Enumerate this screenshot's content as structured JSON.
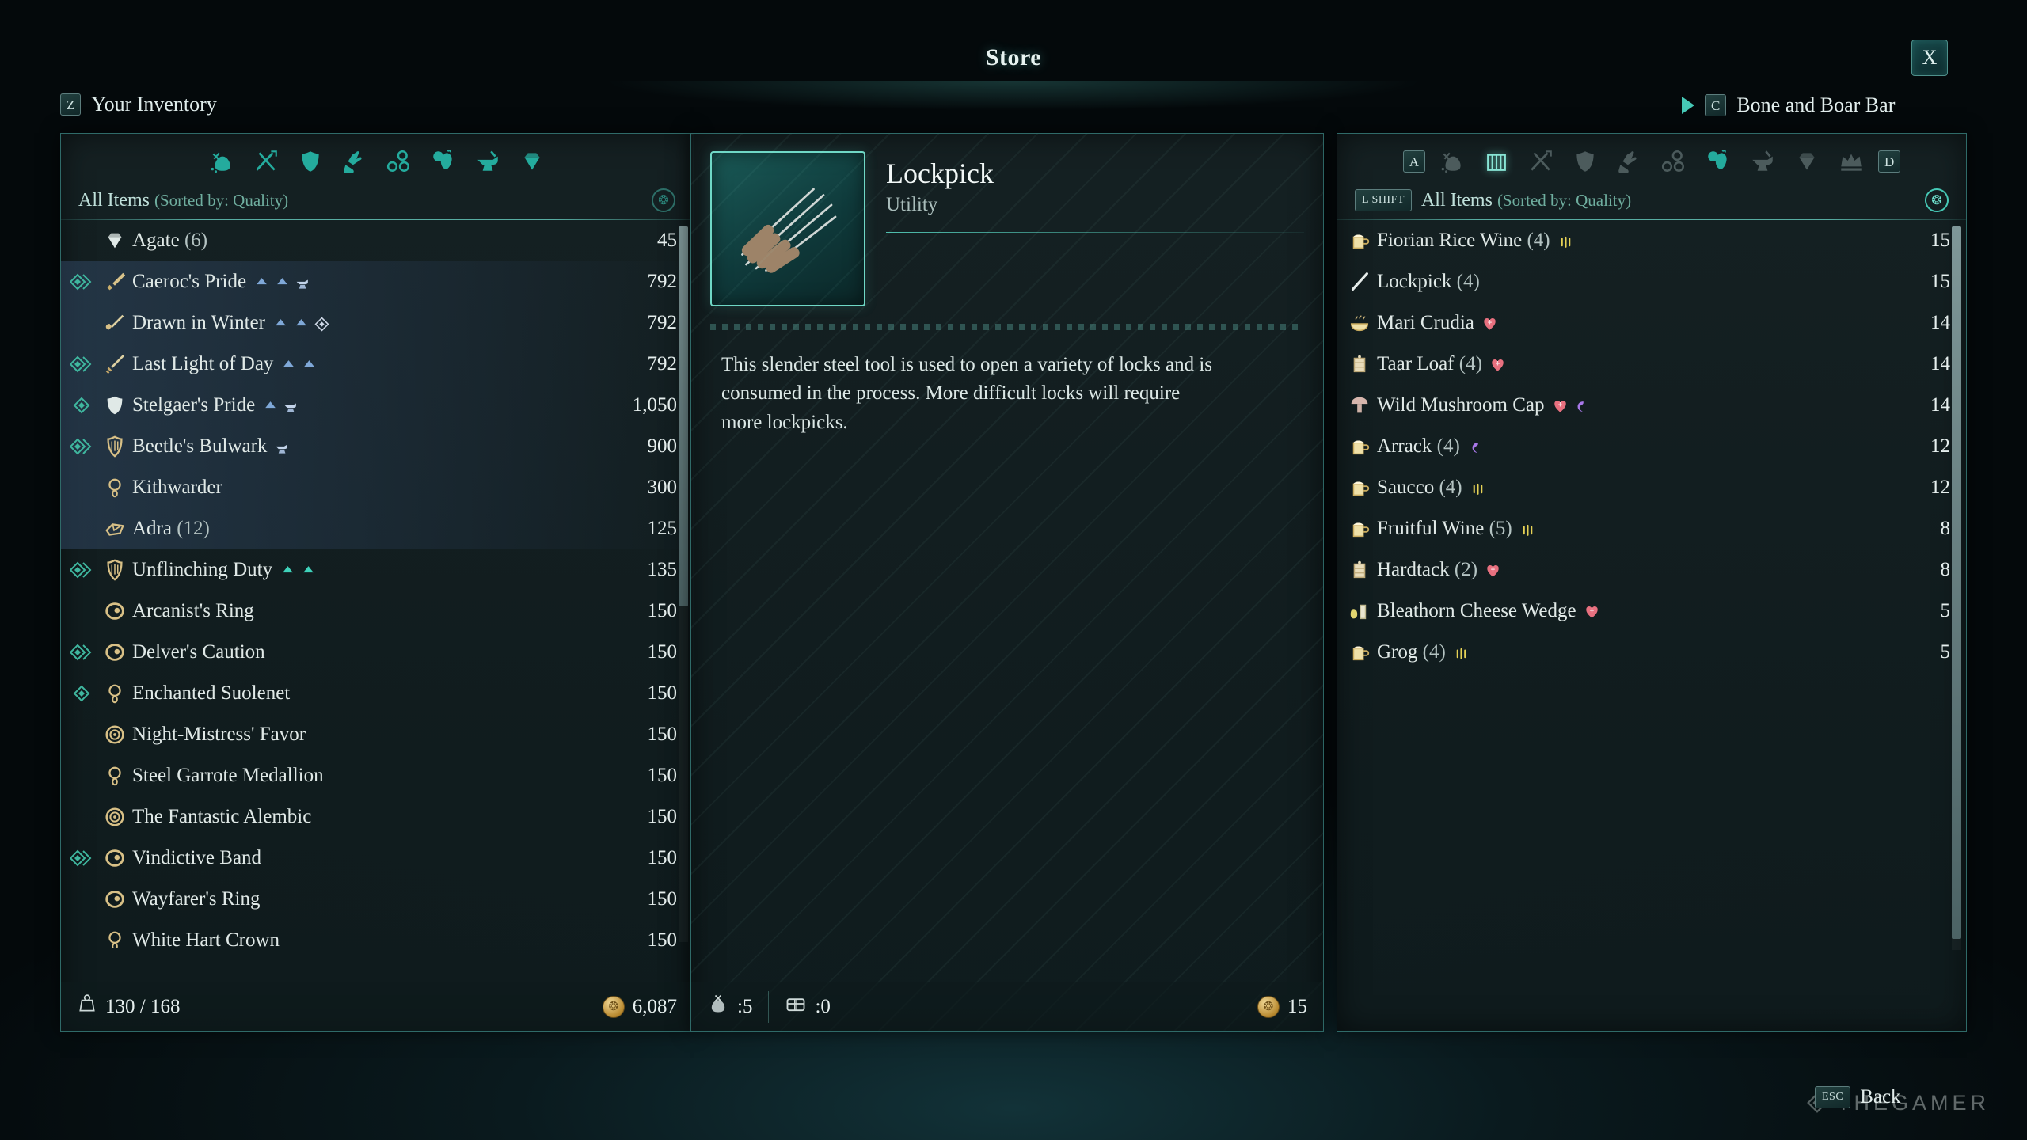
{
  "header": {
    "store_title": "Store",
    "close_label": "X",
    "inventory_key": "Z",
    "inventory_label": "Your Inventory",
    "shop_key": "C",
    "shop_label": "Bone and Boar Bar"
  },
  "left_panel": {
    "sort_key": "",
    "sort_label": "All Items",
    "sort_sub": "(Sorted by: Quality)",
    "weight_label": "130 / 168",
    "gold_label": "6,087",
    "items": [
      {
        "name": "Agate",
        "qty": "(6)",
        "price": "45",
        "icon": "gem-icon",
        "equipped": false,
        "highlight": false,
        "badges": []
      },
      {
        "name": "Caeroc's Pride",
        "qty": "",
        "price": "792",
        "icon": "dagger-icon",
        "equipped": true,
        "eqtype": "double",
        "highlight": true,
        "badges": [
          "up",
          "up",
          "anvil"
        ]
      },
      {
        "name": "Drawn in Winter",
        "qty": "",
        "price": "792",
        "icon": "axe-icon",
        "equipped": false,
        "highlight": true,
        "badges": [
          "up",
          "up",
          "diamond"
        ]
      },
      {
        "name": "Last Light of Day",
        "qty": "",
        "price": "792",
        "icon": "sword-icon",
        "equipped": true,
        "eqtype": "double",
        "highlight": true,
        "badges": [
          "up",
          "up"
        ]
      },
      {
        "name": "Stelgaer's Pride",
        "qty": "",
        "price": "1,050",
        "icon": "armor-icon",
        "equipped": true,
        "eqtype": "single",
        "highlight": true,
        "badges": [
          "up",
          "anvil"
        ]
      },
      {
        "name": "Beetle's Bulwark",
        "qty": "",
        "price": "900",
        "icon": "shield-icon",
        "equipped": true,
        "eqtype": "double",
        "highlight": true,
        "badges": [
          "anvil"
        ]
      },
      {
        "name": "Kithwarder",
        "qty": "",
        "price": "300",
        "icon": "amulet-icon",
        "equipped": false,
        "highlight": true,
        "badges": []
      },
      {
        "name": "Adra",
        "qty": "(12)",
        "price": "125",
        "icon": "adra-icon",
        "equipped": false,
        "highlight": true,
        "badges": []
      },
      {
        "name": "Unflinching Duty",
        "qty": "",
        "price": "135",
        "icon": "shield-icon",
        "equipped": true,
        "eqtype": "double",
        "highlight": false,
        "badges": [
          "upteal",
          "upteal"
        ]
      },
      {
        "name": "Arcanist's Ring",
        "qty": "",
        "price": "150",
        "icon": "ring-icon",
        "equipped": false,
        "highlight": false,
        "badges": []
      },
      {
        "name": "Delver's Caution",
        "qty": "",
        "price": "150",
        "icon": "ring-icon",
        "equipped": true,
        "eqtype": "double",
        "highlight": false,
        "badges": []
      },
      {
        "name": "Enchanted Suolenet",
        "qty": "",
        "price": "150",
        "icon": "amulet-icon",
        "equipped": true,
        "eqtype": "single",
        "highlight": false,
        "badges": []
      },
      {
        "name": "Night-Mistress' Favor",
        "qty": "",
        "price": "150",
        "icon": "medallion-icon",
        "equipped": false,
        "highlight": false,
        "badges": []
      },
      {
        "name": "Steel Garrote Medallion",
        "qty": "",
        "price": "150",
        "icon": "amulet-icon",
        "equipped": false,
        "highlight": false,
        "badges": []
      },
      {
        "name": "The Fantastic Alembic",
        "qty": "",
        "price": "150",
        "icon": "medallion-icon",
        "equipped": false,
        "highlight": false,
        "badges": []
      },
      {
        "name": "Vindictive Band",
        "qty": "",
        "price": "150",
        "icon": "ring-icon",
        "equipped": true,
        "eqtype": "double",
        "highlight": false,
        "badges": []
      },
      {
        "name": "Wayfarer's Ring",
        "qty": "",
        "price": "150",
        "icon": "ring-icon",
        "equipped": false,
        "highlight": false,
        "badges": []
      },
      {
        "name": "White Hart Crown",
        "qty": "",
        "price": "150",
        "icon": "amulet-icon",
        "equipped": false,
        "highlight": false,
        "badges": []
      }
    ],
    "categories": [
      {
        "icon": "loot-bag-icon",
        "state": "on"
      },
      {
        "icon": "weapons-icon",
        "state": "on"
      },
      {
        "icon": "armor-icon",
        "state": "on"
      },
      {
        "icon": "gloves-boots-icon",
        "state": "on"
      },
      {
        "icon": "jewelry-icon",
        "state": "on"
      },
      {
        "icon": "consumables-icon",
        "state": "on"
      },
      {
        "icon": "anvil-icon",
        "state": "on"
      },
      {
        "icon": "gem-icon",
        "state": "on"
      }
    ]
  },
  "detail": {
    "name": "Lockpick",
    "type": "Utility",
    "description": "This slender steel tool is used to open a variety of locks and is consumed in the process. More difficult locks will require more lockpicks.",
    "icon": "lockpick-icon",
    "foot_pouch_count": ":5",
    "foot_stash_count": ":0",
    "foot_price": "15"
  },
  "right_panel": {
    "key_left": "A",
    "key_right": "D",
    "sort_key": "L SHIFT",
    "sort_label": "All Items",
    "sort_sub": "(Sorted by: Quality)",
    "items": [
      {
        "name": "Fiorian Rice Wine",
        "qty": "(4)",
        "price": "15",
        "icon": "mug-icon",
        "badges": [
          "intox"
        ]
      },
      {
        "name": "Lockpick",
        "qty": "(4)",
        "price": "15",
        "icon": "lockpick-small-icon",
        "badges": []
      },
      {
        "name": "Mari Crudia",
        "qty": "",
        "price": "14",
        "icon": "bowl-icon",
        "badges": [
          "heart"
        ]
      },
      {
        "name": "Taar Loaf",
        "qty": "(4)",
        "price": "14",
        "icon": "bread-icon",
        "badges": [
          "heart"
        ]
      },
      {
        "name": "Wild Mushroom Cap",
        "qty": "",
        "price": "14",
        "icon": "mushroom-icon",
        "badges": [
          "heart",
          "spirit"
        ]
      },
      {
        "name": "Arrack",
        "qty": "(4)",
        "price": "12",
        "icon": "mug-icon",
        "badges": [
          "spirit"
        ]
      },
      {
        "name": "Saucco",
        "qty": "(4)",
        "price": "12",
        "icon": "mug-icon",
        "badges": [
          "intox"
        ]
      },
      {
        "name": "Fruitful Wine",
        "qty": "(5)",
        "price": "8",
        "icon": "mug-icon",
        "badges": [
          "intox"
        ]
      },
      {
        "name": "Hardtack",
        "qty": "(2)",
        "price": "8",
        "icon": "bread-icon",
        "badges": [
          "heart"
        ]
      },
      {
        "name": "Bleathorn Cheese Wedge",
        "qty": "",
        "price": "5",
        "icon": "cheese-icon",
        "badges": [
          "heart"
        ]
      },
      {
        "name": "Grog",
        "qty": "(4)",
        "price": "5",
        "icon": "mug-icon",
        "badges": [
          "intox"
        ]
      }
    ],
    "categories": [
      {
        "icon": "loot-bag-icon",
        "state": "dim"
      },
      {
        "icon": "crate-icon",
        "state": "active"
      },
      {
        "icon": "weapons-icon",
        "state": "dim"
      },
      {
        "icon": "armor-icon",
        "state": "dim"
      },
      {
        "icon": "gloves-boots-icon",
        "state": "dim"
      },
      {
        "icon": "jewelry-icon",
        "state": "dim"
      },
      {
        "icon": "consumables-icon",
        "state": "on"
      },
      {
        "icon": "anvil-icon",
        "state": "dim"
      },
      {
        "icon": "gem-icon",
        "state": "dim"
      },
      {
        "icon": "crown-icon",
        "state": "dim"
      }
    ]
  },
  "footer": {
    "esc_key": "ESC",
    "back_label": "Back",
    "watermark": "THEGAMER"
  }
}
